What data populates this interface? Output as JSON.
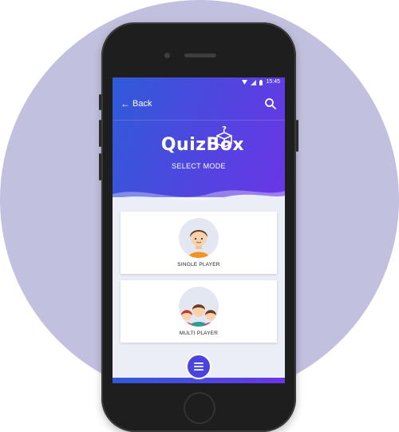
{
  "status_bar": {
    "time": "15:45"
  },
  "app_bar": {
    "back_label": "Back",
    "back_arrow": "←"
  },
  "brand": {
    "logo_text": "QuizBox"
  },
  "header": {
    "subtitle": "SELECT MODE"
  },
  "modes": [
    {
      "label": "SINGLE PLAYER",
      "icon": "single-player-icon"
    },
    {
      "label": "MULTI PLAYER",
      "icon": "multi-player-icon"
    }
  ],
  "fab": {
    "icon": "menu-icon"
  },
  "colors": {
    "background_circle": "#c1c1df",
    "header_start": "#2f5bd8",
    "header_end": "#6a36e6",
    "fab": "#4b43df"
  }
}
